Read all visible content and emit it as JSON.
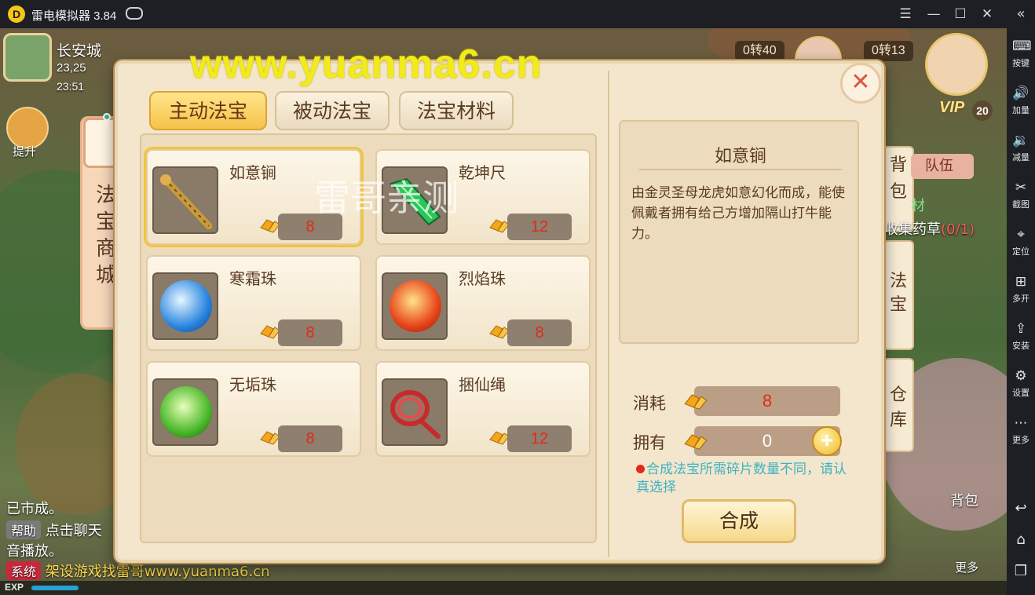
{
  "window": {
    "app_title": "雷电模拟器 3.84",
    "controls": {
      "menu": "☰",
      "minimize": "—",
      "maximize": "☐",
      "close": "✕"
    },
    "collapse": "«"
  },
  "sidebar": {
    "items": [
      {
        "label": "按键",
        "icon": "keyboard-icon",
        "glyph": "⌨"
      },
      {
        "label": "加量",
        "icon": "volume-up-icon",
        "glyph": "🔊"
      },
      {
        "label": "减量",
        "icon": "volume-down-icon",
        "glyph": "🔉"
      },
      {
        "label": "截图",
        "icon": "scissors-icon",
        "glyph": "✂"
      },
      {
        "label": "定位",
        "icon": "location-pin-icon",
        "glyph": "⌖"
      },
      {
        "label": "多开",
        "icon": "multi-instance-icon",
        "glyph": "⊞"
      },
      {
        "label": "安装",
        "icon": "apk-install-icon",
        "glyph": "⇪"
      },
      {
        "label": "设置",
        "icon": "gear-icon",
        "glyph": "⚙"
      },
      {
        "label": "更多",
        "icon": "more-dots-icon",
        "glyph": "⋯"
      }
    ],
    "nav": {
      "back": "↩",
      "home": "⌂",
      "recent": "❐"
    }
  },
  "hud": {
    "city": "长安城",
    "coords": "23,25",
    "time": "23:51",
    "level_left": "0转40",
    "level_right": "0转13",
    "vip": "VIP",
    "vip_level": "20",
    "left_badge": "提升",
    "side_tabs": {
      "bag": "背包",
      "treasure": "法宝",
      "warehouse": "仓库"
    },
    "team": "队伍",
    "quest_sub": "材",
    "quest": "收集药草",
    "quest_progress": "(0/1)",
    "bag_button": "背包",
    "more_button": "更多",
    "chat": {
      "line1": "已市成。",
      "help_tag": "帮助",
      "help_text": "点击聊天",
      "line3": "音播放。",
      "system_tag": "系统",
      "system_text": "架设游戏找雷哥www.yuanma6.cn"
    },
    "exp_label": "EXP"
  },
  "overlay": {
    "watermark": "www.yuanma6.cn",
    "watermark2": "雷哥亲测"
  },
  "modal": {
    "side_tab": [
      "法",
      "宝",
      "商",
      "城"
    ],
    "tabs": [
      {
        "label": "主动法宝",
        "active": true
      },
      {
        "label": "被动法宝",
        "active": false
      },
      {
        "label": "法宝材料",
        "active": false
      }
    ],
    "items": [
      {
        "name": "如意锏",
        "count": "8",
        "icon": "mace-icon",
        "color": "#b07a2a",
        "selected": true
      },
      {
        "name": "乾坤尺",
        "count": "12",
        "icon": "jade-ruler-icon",
        "color": "#22b84a",
        "selected": false
      },
      {
        "name": "寒霜珠",
        "count": "8",
        "icon": "frost-orb-icon",
        "color": "#2a86e0",
        "selected": false
      },
      {
        "name": "烈焰珠",
        "count": "8",
        "icon": "flame-orb-icon",
        "color": "#e8441a",
        "selected": false
      },
      {
        "name": "无垢珠",
        "count": "8",
        "icon": "green-orb-icon",
        "color": "#4ab82a",
        "selected": false
      },
      {
        "name": "捆仙绳",
        "count": "12",
        "icon": "red-rope-icon",
        "color": "#c82a2a",
        "selected": false
      }
    ],
    "detail": {
      "title": "如意锏",
      "description": "由金灵圣母龙虎如意幻化而成，能使佩戴者拥有给己方增加隔山打牛能力。"
    },
    "cost_label": "消耗",
    "cost_value": "8",
    "own_label": "拥有",
    "own_value": "0",
    "hint": "合成法宝所需碎片数量不同，请认真选择",
    "synth_button": "合成",
    "close_glyph": "✕"
  }
}
